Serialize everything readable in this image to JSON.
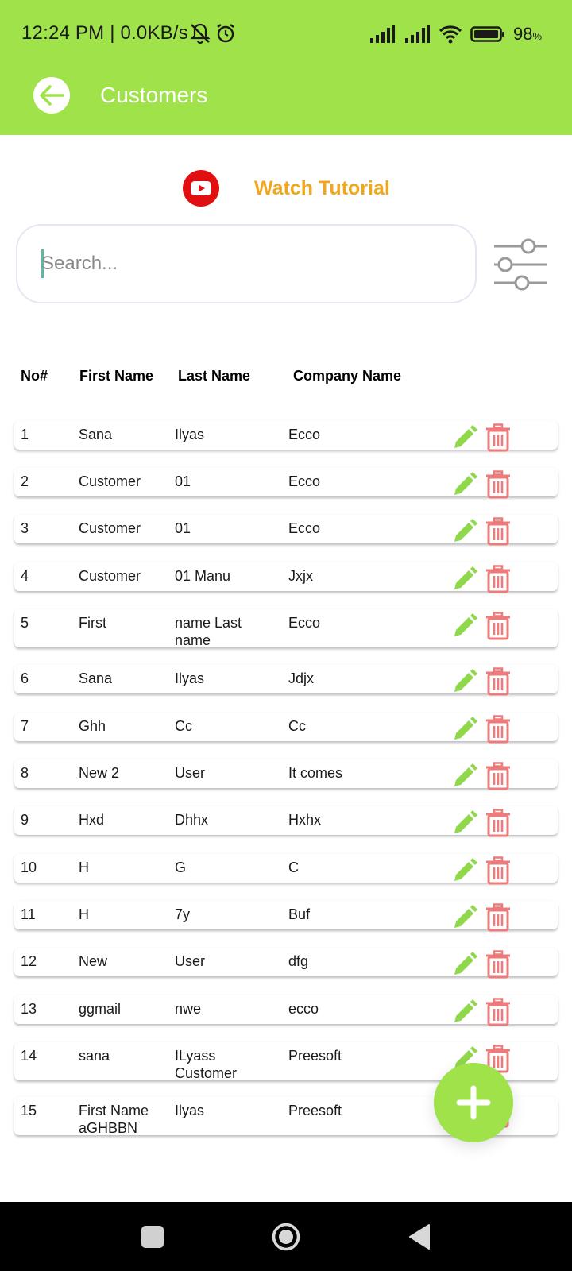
{
  "status_bar": {
    "time": "12:24 PM | 0.0KB/s",
    "battery": "98",
    "battery_unit": "%",
    "icons": [
      "bell-off-icon",
      "alarm-icon",
      "signal-icon",
      "signal-icon",
      "wifi-icon",
      "battery-icon"
    ]
  },
  "header": {
    "title": "Customers",
    "back_icon": "arrow-left-icon"
  },
  "tutorial": {
    "label": "Watch Tutorial",
    "icon": "youtube-play-icon"
  },
  "search": {
    "placeholder": "Search...",
    "value": "",
    "filter_icon": "sliders-icon"
  },
  "table": {
    "columns": [
      "No#",
      "First Name",
      "Last Name",
      "Company Name"
    ],
    "rows": [
      {
        "no": "1",
        "first": "Sana",
        "last": "Ilyas",
        "company": "Ecco"
      },
      {
        "no": "2",
        "first": "Customer",
        "last": "01",
        "company": "Ecco"
      },
      {
        "no": "3",
        "first": "Customer",
        "last": "01",
        "company": "Ecco"
      },
      {
        "no": "4",
        "first": "Customer",
        "last": "01 Manu",
        "company": "Jxjx"
      },
      {
        "no": "5",
        "first": "First",
        "last": "name Last name",
        "company": "Ecco"
      },
      {
        "no": "6",
        "first": "Sana",
        "last": "Ilyas",
        "company": "Jdjx"
      },
      {
        "no": "7",
        "first": "Ghh",
        "last": "Cc",
        "company": "Cc"
      },
      {
        "no": "8",
        "first": "New 2",
        "last": "User",
        "company": "It comes"
      },
      {
        "no": "9",
        "first": "Hxd",
        "last": "Dhhx",
        "company": "Hxhx"
      },
      {
        "no": "10",
        "first": "H",
        "last": "G",
        "company": "C"
      },
      {
        "no": "11",
        "first": "H",
        "last": "7y",
        "company": "Buf"
      },
      {
        "no": "12",
        "first": "New",
        "last": "User",
        "company": "dfg"
      },
      {
        "no": "13",
        "first": "ggmail",
        "last": "nwe",
        "company": "ecco"
      },
      {
        "no": "14",
        "first": "sana",
        "last": "ILyass Customer",
        "company": "Preesoft"
      },
      {
        "no": "15",
        "first": "First Name aGHBBN",
        "last": "Ilyas",
        "company": "Preesoft"
      }
    ],
    "row_actions": [
      "pencil-icon",
      "trash-icon"
    ]
  },
  "fab": {
    "icon": "plus-icon"
  },
  "colors": {
    "accent": "#9fe24a",
    "tutorial": "#f1a71c",
    "youtube": "#e10f0f",
    "edit": "#8fd84a",
    "delete": "#ee7b7b"
  },
  "nav": {
    "icons": [
      "recents-square-icon",
      "home-circle-icon",
      "back-triangle-icon"
    ]
  }
}
